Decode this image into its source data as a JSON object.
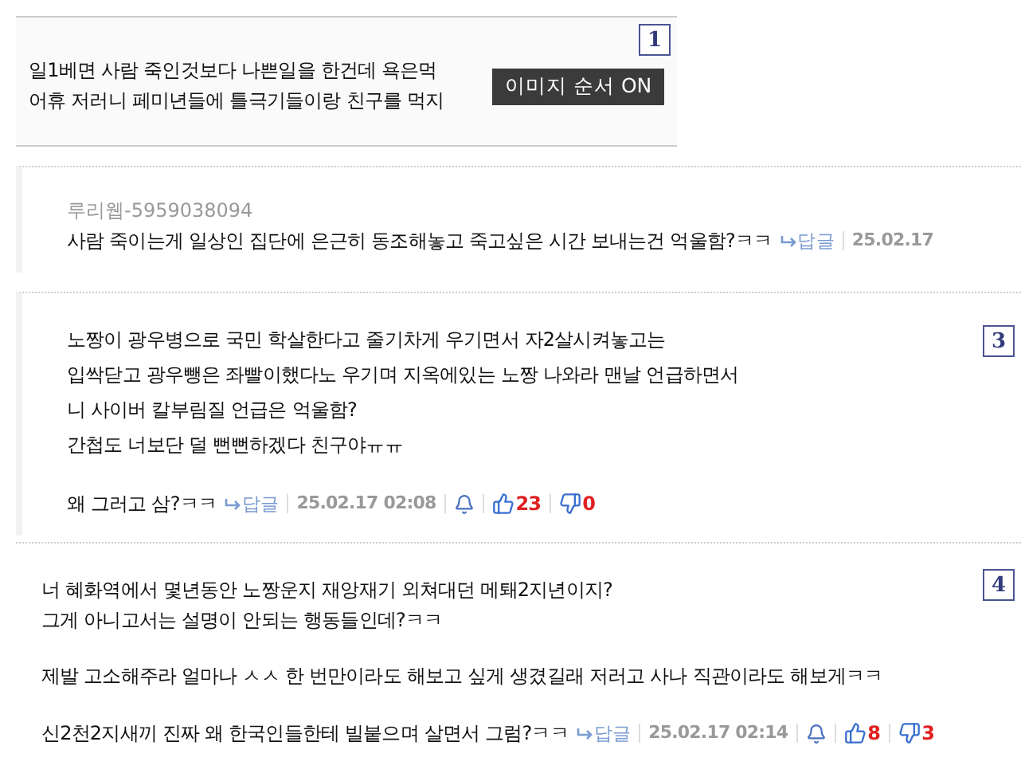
{
  "top_comment": {
    "lines": [
      "일1베면 사람 죽인것보다 나쁜일을 한건데 욕은먹",
      "어휴 저러니 페미년들에 틀극기들이랑 친구를 먹지"
    ],
    "marker": "1",
    "tooltip": "이미지 순서 ON"
  },
  "comments": [
    {
      "author": "루리웹-5959038094",
      "last_line": "사람 죽이는게 일상인 집단에 은근히 동조해놓고 죽고싶은 시간 보내는건 억울함?ㅋㅋ",
      "reply": "답글",
      "date": "25.02.17"
    },
    {
      "paragraphs": [
        [
          "노짱이 광우병으로 국민 학살한다고 줄기차게 우기면서 자2살시켜놓고는",
          "입싹닫고 광우뺑은 좌빨이했다노 우기며 지옥에있는 노짱 나와라 맨날 언급하면서",
          "니 사이버 칼부림질 언급은 억울함?",
          "간첩도 너보단 덜 뻔뻔하겠다 친구야ㅠㅠ"
        ]
      ],
      "last_line": "왜 그러고 삼?ㅋㅋ",
      "reply": "답글",
      "date": "25.02.17 02:08",
      "likes": "23",
      "dislikes": "0",
      "marker": "3"
    },
    {
      "paragraphs": [
        [
          "너 혜화역에서 몇년동안 노짱운지 재앙재기 외쳐대던 메퇘2지년이지?",
          "그게 아니고서는 설명이 안되는 행동들인데?ㅋㅋ"
        ],
        [
          "제발 고소해주라 얼마나 ㅅㅅ 한 번만이라도 해보고 싶게 생겼길래 저러고 사나 직관이라도 해보게ㅋㅋ"
        ]
      ],
      "last_line": "신2천2지새끼 진짜 왜 한국인들한테 빌붙으며 살면서 그럼?ㅋㅋ",
      "reply": "답글",
      "date": "25.02.17 02:14",
      "likes": "8",
      "dislikes": "3",
      "marker": "4"
    }
  ]
}
